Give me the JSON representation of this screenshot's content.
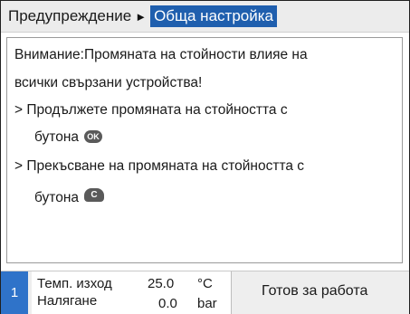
{
  "header": {
    "parent": "Предупреждение",
    "separator": "►",
    "current": "Обща настройка"
  },
  "message": {
    "line1": "Внимание:Промяната на стойности влияе на",
    "line2": "всички свързани устройства!",
    "line3": "> Продължете промяната на стойността с",
    "line4": "бутона",
    "ok_icon": "OK",
    "line5": "> Прекъсване на промяната на стойността с",
    "line6": "бутона",
    "cancel_icon": "C"
  },
  "footer": {
    "level": "1",
    "measurements": [
      {
        "label": "Темп. изход",
        "value": "25.0",
        "unit": "°C"
      },
      {
        "label": "Налягане",
        "value": "0.0",
        "unit": "bar"
      }
    ],
    "status": "Готов за работа"
  },
  "colors": {
    "accent": "#1f5fae",
    "level_badge": "#2f73c9"
  }
}
